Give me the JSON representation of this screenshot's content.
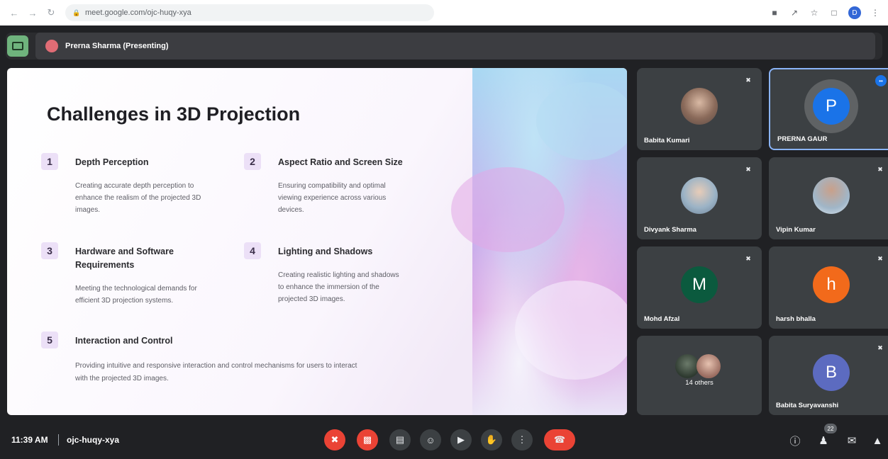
{
  "browser": {
    "url": "meet.google.com/ojc-huqy-xya",
    "profile_initial": "D"
  },
  "presenting": {
    "label": "Prerna Sharma (Presenting)"
  },
  "slide": {
    "title": "Challenges in 3D Projection",
    "items": [
      {
        "num": "1",
        "title": "Depth Perception",
        "desc_lines": [
          "Creating accurate depth perception to",
          "enhance the realism of the projected 3D",
          "images."
        ]
      },
      {
        "num": "2",
        "title": "Aspect Ratio and Screen Size",
        "desc_lines": [
          "Ensuring compatibility and optimal",
          "viewing experience across various",
          "devices."
        ]
      },
      {
        "num": "3",
        "title_lines": [
          "Hardware and Software",
          "Requirements"
        ],
        "desc_lines": [
          "Meeting the technological demands for",
          "efficient 3D projection systems."
        ]
      },
      {
        "num": "4",
        "title": "Lighting and Shadows",
        "desc_lines": [
          "Creating realistic lighting and shadows",
          "to enhance the immersion of the",
          "projected 3D images."
        ]
      },
      {
        "num": "5",
        "title": "Interaction and Control",
        "desc_lines": [
          "Providing intuitive and responsive interaction and control mechanisms for users to interact",
          "with the projected 3D images."
        ]
      }
    ]
  },
  "participants": [
    {
      "name": "Babita Kumari",
      "type": "photo",
      "muted": true
    },
    {
      "name": "PRERNA GAUR",
      "type": "initial",
      "initial": "P",
      "color": "#1a73e8",
      "speaking": true
    },
    {
      "name": "Divyank Sharma",
      "type": "photo",
      "muted": true
    },
    {
      "name": "Vipin Kumar",
      "type": "photo",
      "muted": true
    },
    {
      "name": "Mohd Afzal",
      "type": "initial",
      "initial": "M",
      "color": "#0b5a3e",
      "muted": true
    },
    {
      "name": "harsh bhalla",
      "type": "initial",
      "initial": "h",
      "color": "#f26a1b",
      "muted": true
    },
    {
      "name": "14 others",
      "type": "group"
    },
    {
      "name": "Babita Suryavanshi",
      "type": "initial",
      "initial": "B",
      "color": "#5c6bc0",
      "muted": true
    }
  ],
  "bottom": {
    "time": "11:39 AM",
    "meeting_code": "ojc-huqy-xya",
    "people_count": "22"
  },
  "colors": {
    "meet_red": "#ea4335",
    "tile_bg": "#3c4043",
    "active_border": "#8ab4f8"
  }
}
